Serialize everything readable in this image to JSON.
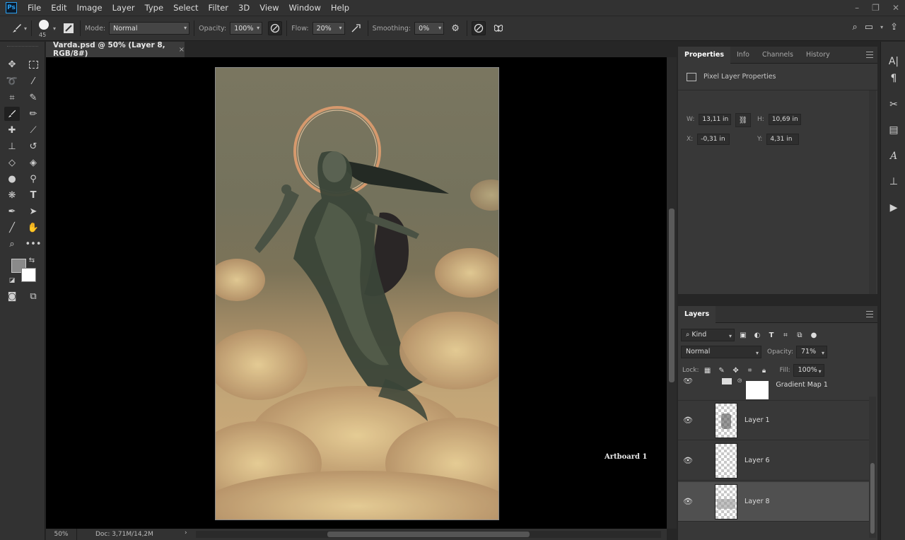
{
  "app": {
    "logo_text": "Ps",
    "menu": [
      "File",
      "Edit",
      "Image",
      "Layer",
      "Type",
      "Select",
      "Filter",
      "3D",
      "View",
      "Window",
      "Help"
    ],
    "window_controls": [
      "–",
      "❐",
      "✕"
    ]
  },
  "options_bar": {
    "brush_size": "45",
    "mode_label": "Mode:",
    "mode_value": "Normal",
    "opacity_label": "Opacity:",
    "opacity_value": "100%",
    "flow_label": "Flow:",
    "flow_value": "20%",
    "smoothing_label": "Smoothing:",
    "smoothing_value": "0%"
  },
  "document": {
    "tab_title": "Varda.psd @ 50% (Layer 8, RGB/8#)",
    "tab_close": "×",
    "artboard_label": "Artboard 1"
  },
  "status": {
    "zoom": "50%",
    "doc_info": "Doc: 3,71M/14,2M"
  },
  "properties_panel": {
    "tabs": [
      "Properties",
      "Info",
      "Channels",
      "History"
    ],
    "heading": "Pixel Layer Properties",
    "w_label": "W:",
    "w_value": "13,11 in",
    "h_label": "H:",
    "h_value": "10,69 in",
    "x_label": "X:",
    "x_value": "-0,31 in",
    "y_label": "Y:",
    "y_value": "4,31 in"
  },
  "layers_panel": {
    "tab": "Layers",
    "filter_kind": "Kind",
    "blend_mode": "Normal",
    "opacity_label": "Opacity:",
    "opacity_value": "71%",
    "lock_label": "Lock:",
    "fill_label": "Fill:",
    "fill_value": "100%",
    "layers": [
      {
        "name": "Gradient Map 1"
      },
      {
        "name": "Layer 1"
      },
      {
        "name": "Layer 6"
      },
      {
        "name": "Layer 8"
      }
    ]
  },
  "colors": {
    "app_bg": "#323232",
    "panel_bg": "#383838",
    "canvas_bg": "#000000",
    "accent_ps": "#2aa0f0",
    "selected_layer": "#505050"
  }
}
